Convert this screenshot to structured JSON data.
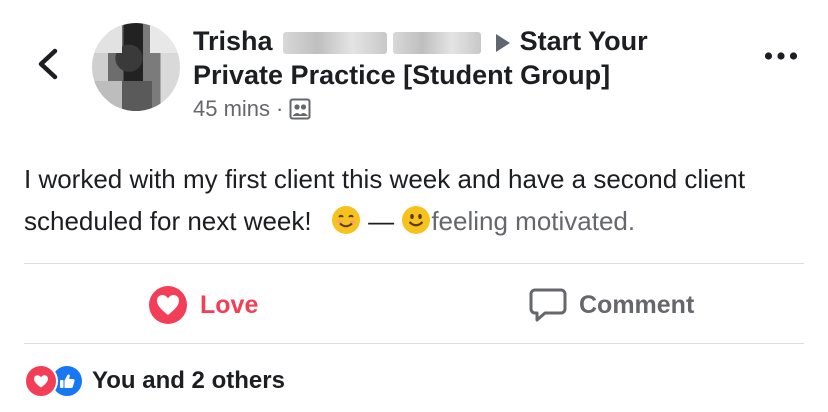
{
  "post": {
    "author_first": "Trisha",
    "group_name_line1": "Start Your",
    "group_name_line2": "Private Practice [Student Group]",
    "time": "45 mins",
    "separator": "·",
    "text_main": "I worked with my first client this week and have a second client scheduled for next week!",
    "dash": "—",
    "feeling": "feeling motivated."
  },
  "actions": {
    "love_label": "Love",
    "comment_label": "Comment"
  },
  "reactions": {
    "summary": "You and 2 others"
  },
  "colors": {
    "love": "#f33e58",
    "like": "#1877f2",
    "secondary_text": "#65676b"
  },
  "icons": [
    "back-chevron-icon",
    "group-privacy-icon",
    "more-dots-icon",
    "heart-icon",
    "comment-bubble-icon",
    "like-thumb-icon",
    "smiling-face-icon"
  ]
}
